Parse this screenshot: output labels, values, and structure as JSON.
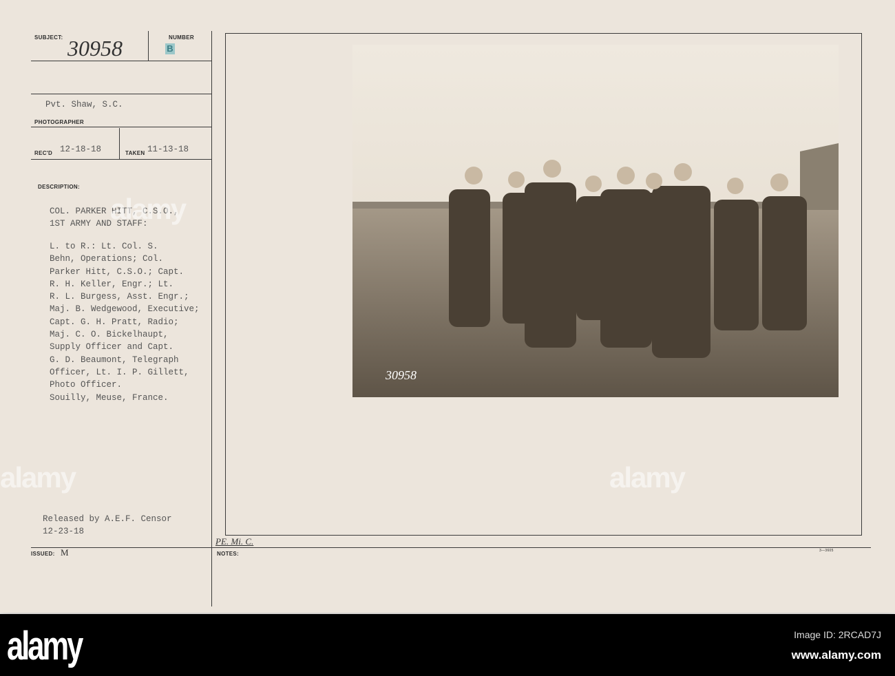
{
  "card": {
    "subject_label": "SUBJECT:",
    "subject_value": "30958",
    "number_label": "NUMBER",
    "number_value": "B",
    "photographer_value": "Pvt. Shaw, S.C.",
    "photographer_label": "PHOTOGRAPHER",
    "recd_label": "REC'D",
    "recd_value": "12-18-18",
    "taken_label": "TAKEN",
    "taken_value": "11-13-18",
    "description_label": "DESCRIPTION:",
    "description_title": "COL. PARKER HITT, C.S.O.,\n1ST ARMY AND STAFF:",
    "description_body": "L. to R.: Lt. Col. S.\nBehn, Operations; Col.\nParker Hitt, C.S.O.; Capt.\nR. H. Keller, Engr.; Lt.\nR. L. Burgess, Asst. Engr.;\nMaj. B. Wedgewood, Executive;\nCapt. G. H. Pratt, Radio;\nMaj. C. O. Bickelhaupt,\nSupply Officer and Capt.\nG. D. Beaumont, Telegraph\nOfficer, Lt. I. P. Gillett,\nPhoto Officer.\nSouilly, Meuse, France.",
    "released": "Released by A.E.F. Censor\n12-23-18",
    "issued_label": "ISSUED:",
    "issued_value": "M",
    "notes_label": "NOTES:",
    "notes_handwritten": "PE. Mi. C.",
    "form_number": "3—3605",
    "photo_stamp": "30958"
  },
  "watermark": {
    "text": "alamy",
    "logo": "alamy",
    "image_id": "Image ID: 2RCAD7J",
    "url": "www.alamy.com"
  }
}
